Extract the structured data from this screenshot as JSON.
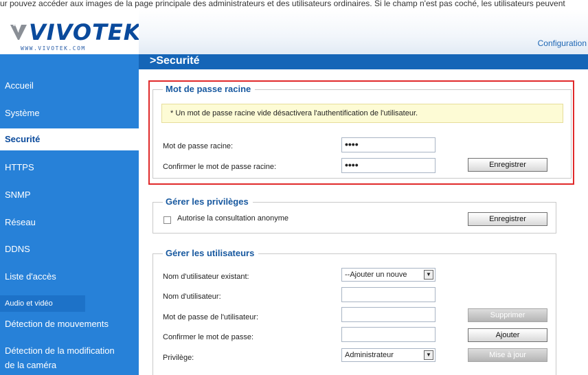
{
  "top_strip_text": "ur pouvez accéder aux images de la page principale des administrateurs et des utilisateurs ordinaires. Si le champ n'est pas coché, les utilisateurs peuvent",
  "brand": {
    "logo_text": "VIVOTEK",
    "logo_url": "WWW.VIVOTEK.COM"
  },
  "header": {
    "config_link": "Configuration",
    "title": ">Securité"
  },
  "sidebar": {
    "items": [
      {
        "label": "Accueil",
        "active": false
      },
      {
        "label": "Système",
        "active": false
      },
      {
        "label": "Securité",
        "active": true
      },
      {
        "label": "HTTPS",
        "active": false
      },
      {
        "label": "SNMP",
        "active": false
      },
      {
        "label": "Réseau",
        "active": false
      },
      {
        "label": "DDNS",
        "active": false
      },
      {
        "label": "Liste d'accès",
        "active": false
      },
      {
        "label": "Audio et vidéo",
        "active": false
      },
      {
        "label": "Détection de mouvements",
        "active": false
      },
      {
        "label": "Détection de la modification",
        "active": false
      },
      {
        "label": "de la caméra",
        "active": false
      }
    ]
  },
  "root_password": {
    "legend": "Mot de passe racine",
    "notice": "* Un mot de passe racine vide désactivera l'authentification de l'utilisateur.",
    "password_label": "Mot de passe racine:",
    "password_value": "••••",
    "confirm_label": "Confirmer le mot de passe racine:",
    "confirm_value": "••••",
    "save_button": "Enregistrer",
    "highlight_color": "#e0292a"
  },
  "privileges": {
    "legend": "Gérer les privilèges",
    "anonymous_label": "Autorise la consultation anonyme",
    "anonymous_checked": false,
    "save_button": "Enregistrer"
  },
  "users": {
    "legend": "Gérer les utilisateurs",
    "existing_label": "Nom d'utilisateur existant:",
    "existing_value": "--Ajouter un nouve",
    "username_label": "Nom d'utilisateur:",
    "username_value": "",
    "password_label": "Mot de passe de l'utilisateur:",
    "password_value": "",
    "confirm_label": "Confirmer le mot de passe:",
    "confirm_value": "",
    "privilege_label": "Privilège:",
    "privilege_value": "Administrateur",
    "delete_button": "Supprimer",
    "add_button": "Ajouter",
    "update_button": "Mise à jour"
  },
  "colors": {
    "sidebar": "#2781d8",
    "titlebar": "#1565b7",
    "legend_text": "#17589f",
    "notice_bg": "#fdfbd5"
  }
}
